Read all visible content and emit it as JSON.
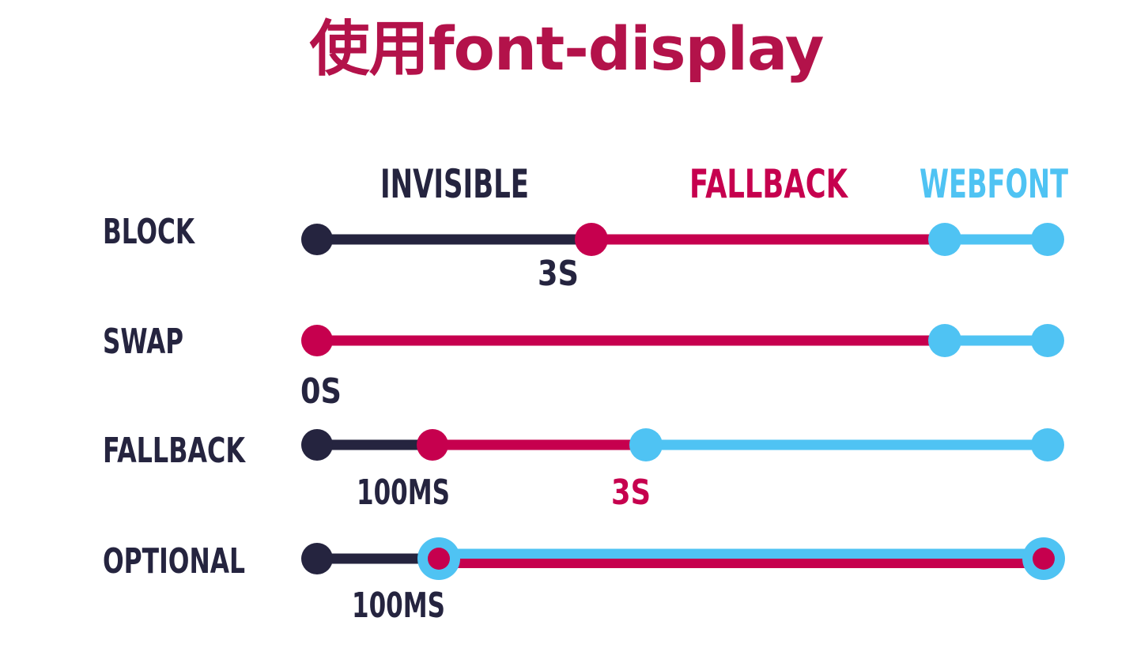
{
  "title": "使用font-display",
  "colors": {
    "title": "#b3124a",
    "invisible": "#25243f",
    "fallback": "#c6004e",
    "webfont": "#4fc3f3",
    "text_dark": "#25243f"
  },
  "legend": {
    "invisible": "INVISIBLE",
    "fallback": "FALLBACK",
    "webfont": "WEBFONT"
  },
  "rows": [
    {
      "id": "block",
      "label": "BLOCK",
      "time_labels": [
        "3S"
      ]
    },
    {
      "id": "swap",
      "label": "SWAP",
      "time_labels": [
        "0S"
      ]
    },
    {
      "id": "fallback",
      "label": "FALLBACK",
      "time_labels": [
        "100MS",
        "3S"
      ]
    },
    {
      "id": "optional",
      "label": "OPTIONAL",
      "time_labels": [
        "100MS"
      ]
    }
  ]
}
